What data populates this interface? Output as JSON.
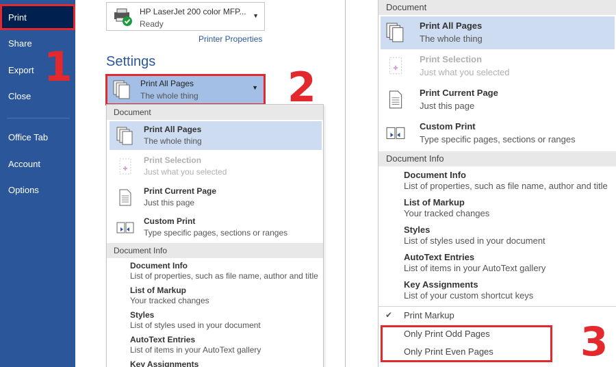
{
  "sidebar": {
    "items": [
      {
        "label": "Print",
        "active": true
      },
      {
        "label": "Share"
      },
      {
        "label": "Export"
      },
      {
        "label": "Close"
      },
      {
        "label": "Office Tab"
      },
      {
        "label": "Account"
      },
      {
        "label": "Options"
      }
    ]
  },
  "callouts": [
    "1",
    "2",
    "3"
  ],
  "printer": {
    "name": "HP LaserJet 200 color MFP...",
    "status": "Ready",
    "properties_link": "Printer Properties"
  },
  "settings": {
    "title": "Settings",
    "selected_label": "Print All Pages",
    "selected_desc": "The whole thing"
  },
  "menu": {
    "document_header": "Document",
    "document_items": [
      {
        "label": "Print All Pages",
        "desc": "The whole thing",
        "icon": "all-pages-icon"
      },
      {
        "label": "Print Selection",
        "desc": "Just what you selected",
        "icon": "selection-icon"
      },
      {
        "label": "Print Current Page",
        "desc": "Just this page",
        "icon": "current-page-icon"
      },
      {
        "label": "Custom Print",
        "desc": "Type specific pages, sections or ranges",
        "icon": "custom-print-icon"
      }
    ],
    "docinfo_header": "Document Info",
    "docinfo_items": [
      {
        "label": "Document Info",
        "desc": "List of properties, such as file name, author and title"
      },
      {
        "label": "List of Markup",
        "desc": "Your tracked changes"
      },
      {
        "label": "Styles",
        "desc": "List of styles used in your document"
      },
      {
        "label": "AutoText Entries",
        "desc": "List of items in your AutoText gallery"
      },
      {
        "label": "Key Assignments",
        "desc": "List of your custom shortcut keys"
      }
    ],
    "print_markup": "Print Markup",
    "odd_pages": "Only Print Odd Pages",
    "even_pages": "Only Print Even Pages"
  },
  "colors": {
    "sidebar": "#2b579a",
    "highlight": "#e2292e",
    "selected_row": "#cddcf0"
  }
}
